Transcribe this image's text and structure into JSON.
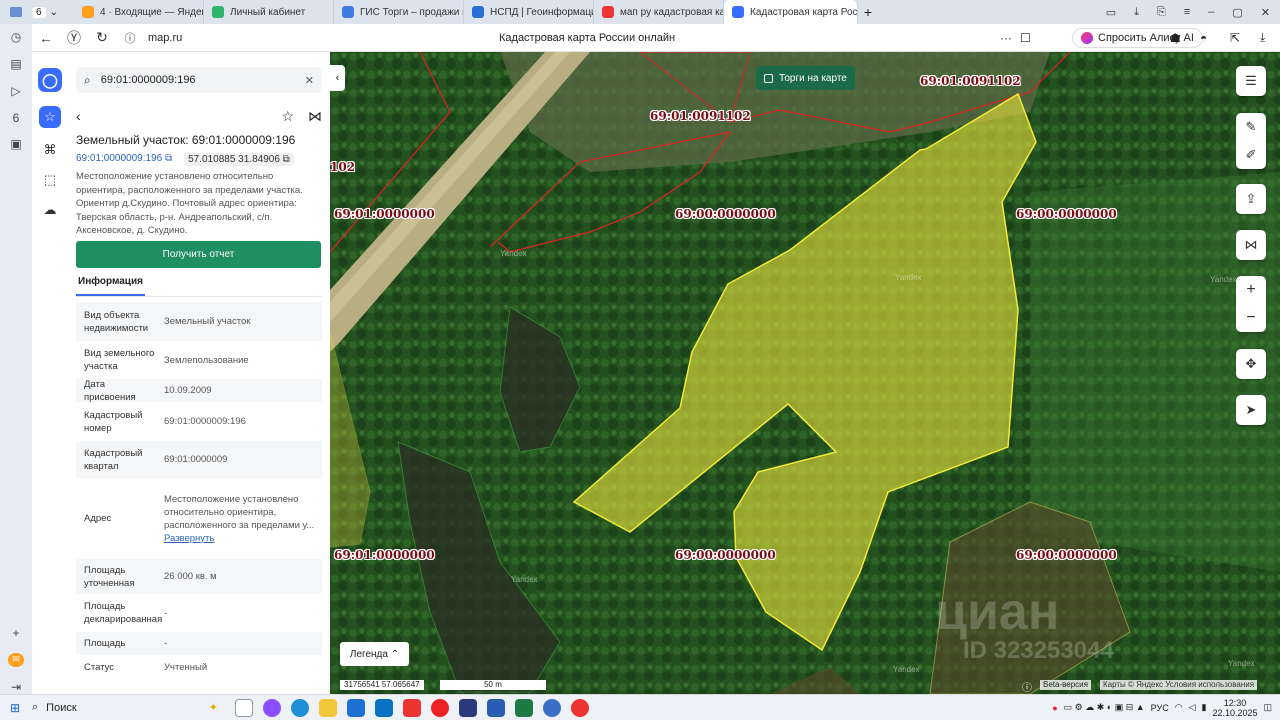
{
  "browser": {
    "tab_count": "6",
    "tabs": [
      {
        "label": "4 · Входящие — Яндекс П",
        "color": "#ff9f1c"
      },
      {
        "label": "Личный кабинет",
        "color": "#2db36b"
      },
      {
        "label": "ГИС Торги – продажи гос",
        "color": "#3d7be0"
      },
      {
        "label": "НСПД | Геоинформацио",
        "color": "#2a6fd8"
      },
      {
        "label": "мап ру кадастровая карт",
        "color": "#e33"
      },
      {
        "label": "Кадастровая карта Рос",
        "color": "#3a6bff"
      }
    ],
    "url": "map.ru",
    "page_title": "Кадастровая карта России онлайн",
    "alice_label": "Спросить Алису AI"
  },
  "panel": {
    "search_value": "69:01:0000009:196",
    "title": "Земельный участок: 69:01:0000009:196",
    "chip_number": "69:01:0000009:196",
    "chip_coords": "57.010885 31.84906",
    "description": "Местоположение установлено относительно ориентира, расположенного за пределами участка. Ориентир д.Скудино. Почтовый адрес ориентира: Тверская область, р-н. Андреапольский, с/п. Аксеновское, д. Скудино.",
    "report_button": "Получить отчет",
    "info_tab": "Информация",
    "rows": [
      {
        "k": "Вид объекта недвижимости",
        "v": "Земельный участок"
      },
      {
        "k": "Вид земельного участка",
        "v": "Землепользование"
      },
      {
        "k": "Дата присвоения",
        "v": "10.09.2009"
      },
      {
        "k": "Кадастровый номер",
        "v": "69:01:0000009:196"
      },
      {
        "k": "Кадастровый квартал",
        "v": "69:01:0000009"
      },
      {
        "k": "Адрес",
        "v": "Местоположение установлено относительно ориентира, расположенного за пределами у...",
        "link": "Развернуть"
      },
      {
        "k": "Площадь уточненная",
        "v": "26 000 кв. м"
      },
      {
        "k": "Площадь декларированная",
        "v": "-"
      },
      {
        "k": "Площадь",
        "v": "-"
      },
      {
        "k": "Статус",
        "v": "Учтенный"
      }
    ]
  },
  "map": {
    "torgi_label": "Торги на карте",
    "labels": [
      "69:01:0091102",
      "69:01:0091102",
      "102",
      "69:01:0000000",
      "69:00:0000000",
      "69:00:0000000",
      "69:01:0000000",
      "69:00:0000000",
      "69:00:0000000"
    ],
    "yandex_wm": "Yandex",
    "legend_label": "Легенда",
    "coords": "31756541  57.065647",
    "scale_label": "50 m",
    "beta_label": "Beta-версия",
    "copyright": "Карты © Яндекс   Условия использования",
    "cian": "циан",
    "cian_id": "ID 323253044"
  },
  "taskbar": {
    "search_label": "Поиск",
    "lang": "РУС",
    "time": "12:30",
    "date": "22.10.2025"
  }
}
